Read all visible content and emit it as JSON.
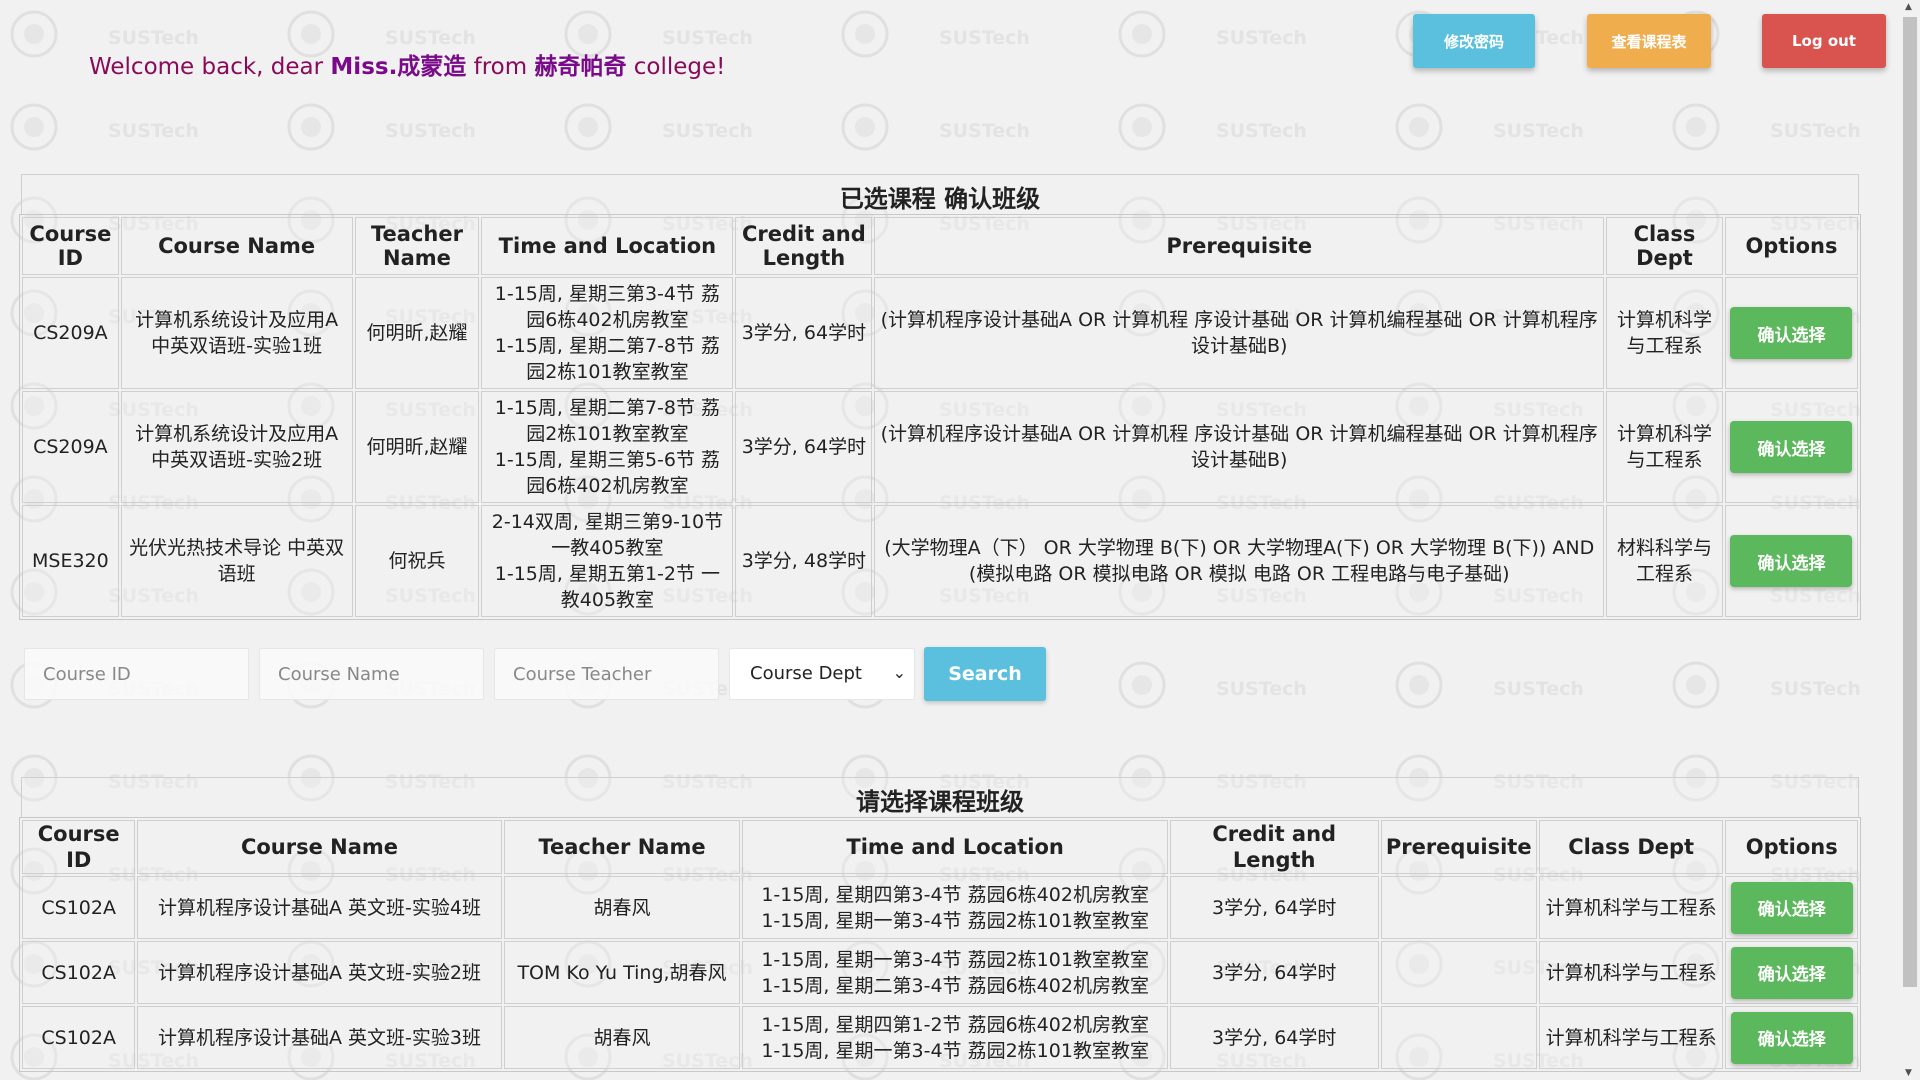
{
  "header": {
    "welcome_prefix": "Welcome back, dear ",
    "user_name": "Miss.成蒙造",
    "from_word": " from ",
    "college_name": "赫奇帕奇",
    "welcome_suffix": " college!",
    "change_password_label": "修改密码",
    "view_schedule_label": "查看课程表",
    "logout_label": "Log out"
  },
  "watermark": {
    "text": "SUSTech"
  },
  "selected_courses": {
    "title": "已选课程 确认班级",
    "headers": [
      "Course ID",
      "Course Name",
      "Teacher Name",
      "Time and Location",
      "Credit and Length",
      "Prerequisite",
      "Class Dept",
      "Options"
    ],
    "rows": [
      {
        "course_id": "CS209A",
        "course_name": "计算机系统设计及应用A 中英双语班-实验1班",
        "teacher": "何明昕,赵耀",
        "time_1": "1-15周, 星期三第3-4节 荔园6栋402机房教室",
        "time_2": "1-15周, 星期二第7-8节 荔园2栋101教室教室",
        "credit": "3学分, 64学时",
        "prerequisite": "(计算机程序设计基础A OR 计算机程 序设计基础 OR 计算机编程基础 OR 计算机程序设计基础B)",
        "dept": "计算机科学与工程系",
        "option": "确认选择"
      },
      {
        "course_id": "CS209A",
        "course_name": "计算机系统设计及应用A 中英双语班-实验2班",
        "teacher": "何明昕,赵耀",
        "time_1": "1-15周, 星期二第7-8节 荔园2栋101教室教室",
        "time_2": "1-15周, 星期三第5-6节 荔园6栋402机房教室",
        "credit": "3学分, 64学时",
        "prerequisite": "(计算机程序设计基础A OR 计算机程 序设计基础 OR 计算机编程基础 OR 计算机程序设计基础B)",
        "dept": "计算机科学与工程系",
        "option": "确认选择"
      },
      {
        "course_id": "MSE320",
        "course_name": "光伏光热技术导论 中英双语班",
        "teacher": "何祝兵",
        "time_1": "2-14双周, 星期三第9-10节 一教405教室",
        "time_2": "1-15周, 星期五第1-2节 一教405教室",
        "credit": "3学分, 48学时",
        "prerequisite": "(大学物理A（下） OR 大学物理 B(下) OR 大学物理A(下) OR 大学物理 B(下)) AND (模拟电路 OR 模拟电路 OR 模拟 电路 OR 工程电路与电子基础)",
        "dept": "材料科学与工程系",
        "option": "确认选择"
      }
    ]
  },
  "search": {
    "course_id_placeholder": "Course ID",
    "course_name_placeholder": "Course Name",
    "course_teacher_placeholder": "Course Teacher",
    "dept_selected": "Course Dept",
    "search_label": "Search"
  },
  "available_courses": {
    "title": "请选择课程班级",
    "headers": [
      "Course ID",
      "Course Name",
      "Teacher Name",
      "Time and Location",
      "Credit and Length",
      "Prerequisite",
      "Class Dept",
      "Options"
    ],
    "rows": [
      {
        "course_id": "CS102A",
        "course_name": "计算机程序设计基础A 英文班-实验4班",
        "teacher": "胡春风",
        "time_1": "1-15周, 星期四第3-4节 荔园6栋402机房教室",
        "time_2": "1-15周, 星期一第3-4节 荔园2栋101教室教室",
        "credit": "3学分, 64学时",
        "prerequisite": "",
        "dept": "计算机科学与工程系",
        "option": "确认选择"
      },
      {
        "course_id": "CS102A",
        "course_name": "计算机程序设计基础A 英文班-实验2班",
        "teacher": "TOM Ko Yu Ting,胡春风",
        "time_1": "1-15周, 星期一第3-4节 荔园2栋101教室教室",
        "time_2": "1-15周, 星期二第3-4节 荔园6栋402机房教室",
        "credit": "3学分, 64学时",
        "prerequisite": "",
        "dept": "计算机科学与工程系",
        "option": "确认选择"
      },
      {
        "course_id": "CS102A",
        "course_name": "计算机程序设计基础A 英文班-实验3班",
        "teacher": "胡春风",
        "time_1": "1-15周, 星期四第1-2节 荔园6栋402机房教室",
        "time_2": "1-15周, 星期一第3-4节 荔园2栋101教室教室",
        "credit": "3学分, 64学时",
        "prerequisite": "",
        "dept": "计算机科学与工程系",
        "option": "确认选择"
      }
    ]
  },
  "colors": {
    "welcome": "#8a0a5a",
    "info_button": "#5bc0de",
    "warning_button": "#f0ad4e",
    "danger_button": "#d9534f",
    "success_button": "#5cb85c"
  }
}
